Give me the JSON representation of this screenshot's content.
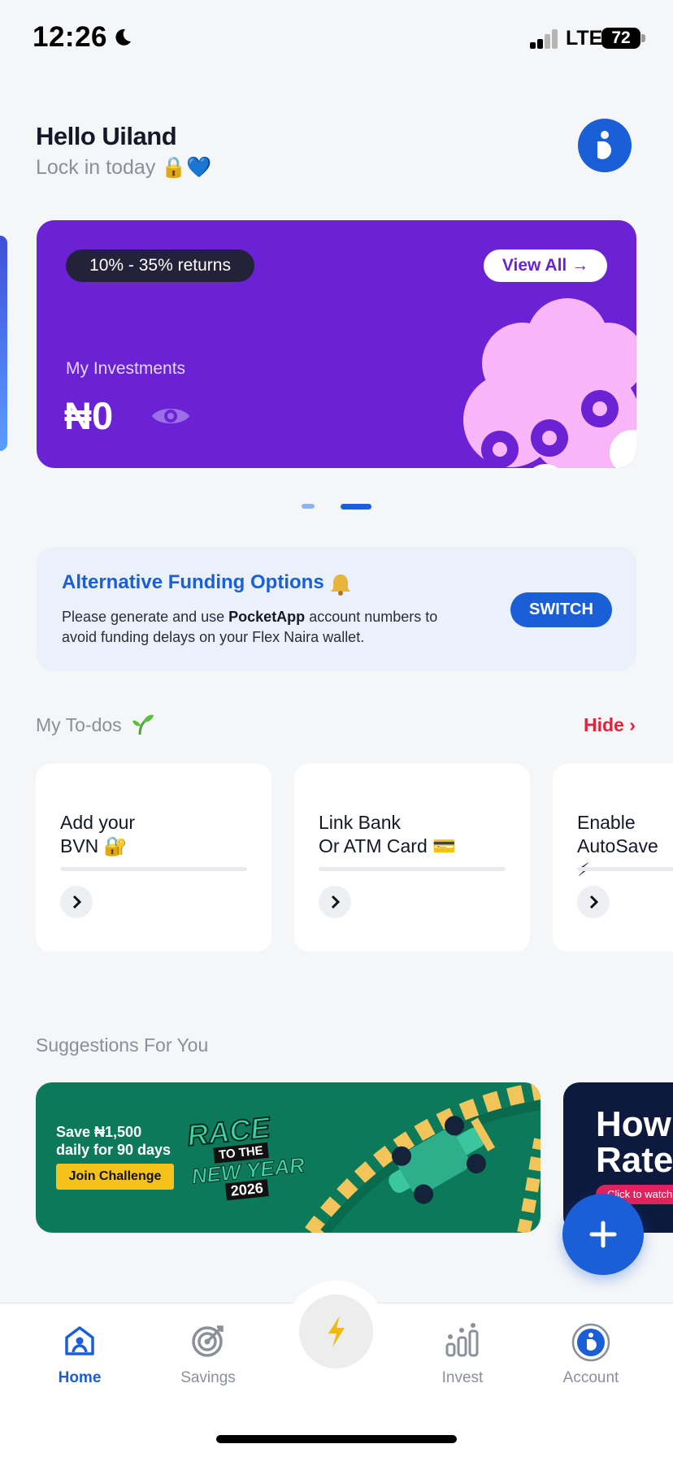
{
  "status_bar": {
    "time": "12:26",
    "network": "LTE",
    "battery": "72"
  },
  "header": {
    "greeting": "Hello Uiland",
    "subtitle": "Lock in today 🔒💙"
  },
  "investment_card": {
    "returns_badge": "10% - 35% returns",
    "view_all_label": "View All →",
    "label": "My Investments",
    "amount": "₦0",
    "accent_color": "#6b21d4"
  },
  "carousel": {
    "active_index": 1,
    "count": 2
  },
  "funding": {
    "title": "Alternative Funding Options",
    "text_before": "Please generate and use ",
    "brand": "PocketApp",
    "text_after": " account numbers to avoid funding delays on your Flex Naira wallet.",
    "switch_label": "SWITCH"
  },
  "todos": {
    "title": "My To-dos",
    "hide_label": "Hide",
    "items": [
      {
        "label": "Add your\nBVN 🔐"
      },
      {
        "label": "Link Bank\nOr ATM Card 💳"
      },
      {
        "label": "Enable\nAutoSave ⚡"
      }
    ]
  },
  "suggestions": {
    "title": "Suggestions For You",
    "banner1": {
      "save_text": "Save ₦1,500 daily for 90 days",
      "join_label": "Join Challenge",
      "logo_line1": "RACE",
      "logo_line2": "TO THE",
      "logo_line3": "NEW YEAR",
      "logo_year": "2026"
    },
    "banner2": {
      "text": "How Rates",
      "pill": "Click to watch"
    }
  },
  "bottom_nav": {
    "items": [
      {
        "label": "Home",
        "icon": "home-icon",
        "active": true
      },
      {
        "label": "Savings",
        "icon": "target-icon",
        "active": false
      },
      {
        "label": "Invest",
        "icon": "invest-icon",
        "active": false
      },
      {
        "label": "Account",
        "icon": "account-icon",
        "active": false
      }
    ],
    "center_icon": "lightning-icon"
  },
  "colors": {
    "primary": "#1a5fd8",
    "danger": "#e0243b",
    "purple": "#6b21d4"
  }
}
